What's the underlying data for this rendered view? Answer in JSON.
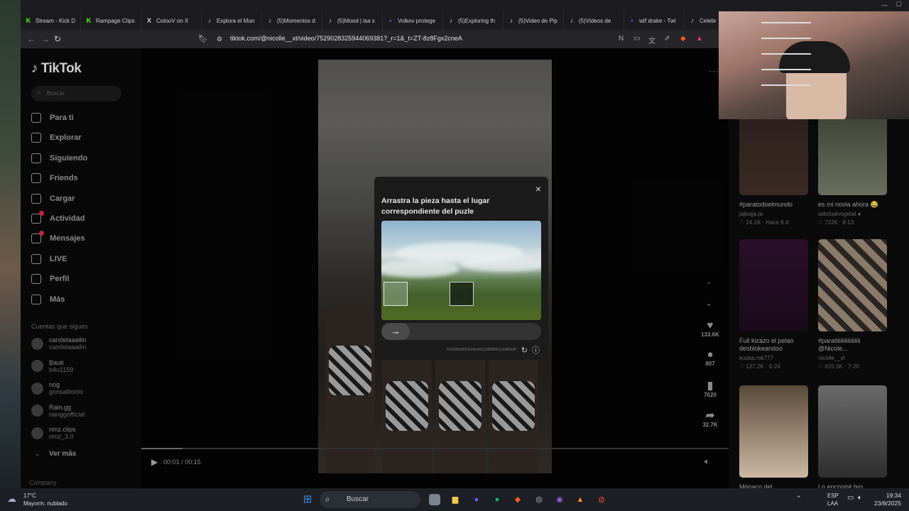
{
  "tabs": [
    {
      "label": "Stream - Kick D",
      "icon": "K",
      "color": "#53fc18"
    },
    {
      "label": "Rampage Clips",
      "icon": "K",
      "color": "#53fc18"
    },
    {
      "label": "CotooV on X",
      "icon": "X",
      "color": "#cfcfcf"
    },
    {
      "label": "Explora el Mun",
      "icon": "♪",
      "color": "#cfcfcf"
    },
    {
      "label": "(5)Momentos d",
      "icon": "♪",
      "color": "#cfcfcf"
    },
    {
      "label": "(5)Mood | isa s",
      "icon": "♪",
      "color": "#cfcfcf"
    },
    {
      "label": "Volkov protege",
      "icon": "▪",
      "color": "#9146ff"
    },
    {
      "label": "(5)Exploring th",
      "icon": "♪",
      "color": "#cfcfcf"
    },
    {
      "label": "(5)Video de Pip",
      "icon": "♪",
      "color": "#cfcfcf"
    },
    {
      "label": "(5)Videos de",
      "icon": "♪",
      "color": "#cfcfcf"
    },
    {
      "label": "wtf drake - Twi",
      "icon": "▪",
      "color": "#9146ff"
    },
    {
      "label": "Celebr",
      "icon": "♪",
      "color": "#cfcfcf"
    }
  ],
  "address": {
    "url": "tiktok.com/@nicolle__xt/video/7529028325944069381?_r=1&_t=ZT-8z8Fgx2cneA"
  },
  "sidebar": {
    "logo": "TikTok",
    "search_placeholder": "Buscar",
    "nav": [
      {
        "label": "Para ti",
        "badge": false
      },
      {
        "label": "Explorar",
        "badge": false
      },
      {
        "label": "Siguiendo",
        "badge": false
      },
      {
        "label": "Friends",
        "badge": false
      },
      {
        "label": "Cargar",
        "badge": false
      },
      {
        "label": "Actividad",
        "badge": true
      },
      {
        "label": "Mensajes",
        "badge": true
      },
      {
        "label": "LIVE",
        "badge": false
      },
      {
        "label": "Perfil",
        "badge": false
      },
      {
        "label": "Más",
        "badge": false
      }
    ],
    "following_header": "Cuentas que sigues",
    "following": [
      {
        "name": "candelaaailin",
        "handle": "candelaaailin"
      },
      {
        "name": "Bauti",
        "handle": "b4u1159"
      },
      {
        "name": "nog",
        "handle": "gonsalitonlo"
      },
      {
        "name": "Rain.gg",
        "handle": "rainggofficial"
      },
      {
        "name": "nmz.clips",
        "handle": "nmz_3.0"
      }
    ],
    "see_more": "Ver más",
    "company": "Company"
  },
  "captcha": {
    "title": "Arrastra la pieza hasta el lugar correspondiente del puzle",
    "close": "×",
    "slider_arrow": "→",
    "id_text": "2025082050544461506209BB8FE1DB8D4D"
  },
  "actions": {
    "likes": "133.6K",
    "comments": "807",
    "saves": "7620",
    "shares": "32.7K"
  },
  "player": {
    "time": "00:01 / 00:15",
    "progress": 0.07
  },
  "right": {
    "items": [
      {
        "caption": "#paratodoelmundo",
        "user": "jajkajja.ja",
        "stats": "♡ 24.1K · Hace 6 d"
      },
      {
        "caption": "es mi novia ahora 😂",
        "user": "adictoalvogetal ●",
        "stats": "♡ 7226 · 8-13"
      },
      {
        "caption": "Full kizazo el pelao desblokeandoo",
        "user": "kodaa.mk777",
        "stats": "♡ 127.2K · 6-24"
      },
      {
        "caption": "#paratiiiiiiiiiiiiiiiii @Nicole...",
        "user": "nicolle__xt",
        "stats": "♡ 615.5K · 7-20"
      },
      {
        "caption": "Mónaco del",
        "user": "",
        "stats": ""
      },
      {
        "caption": "Lo encontré bro",
        "user": "",
        "stats": ""
      }
    ]
  },
  "taskbar": {
    "temp": "17°C",
    "weather": "Mayorm. nublado",
    "search": "Buscar",
    "lang1": "ESP",
    "lang2": "LAA",
    "time": "19:34",
    "date": "23/8/2025"
  }
}
